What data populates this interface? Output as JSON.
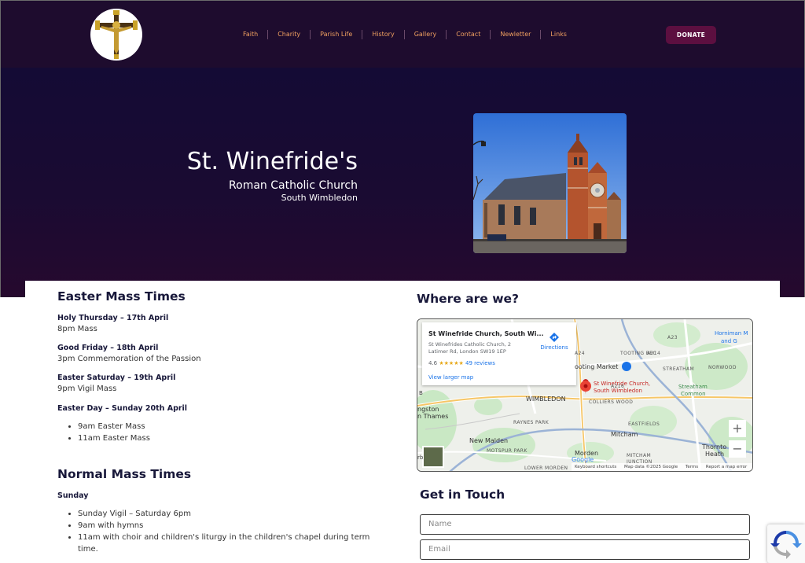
{
  "header": {
    "nav": [
      "Faith",
      "Charity",
      "Parish Life",
      "History",
      "Gallery",
      "Contact",
      "Newletter",
      "Links"
    ],
    "donate_label": "DONATE"
  },
  "hero": {
    "title": "St. Winefride's",
    "subtitle": "Roman Catholic Church",
    "location": "South Wimbledon"
  },
  "easter": {
    "heading": "Easter Mass Times",
    "holy_thursday_title": "Holy Thursday – 17th April",
    "holy_thursday_time": "8pm Mass",
    "good_friday_title": "Good Friday – 18th April",
    "good_friday_time": "3pm Commemoration of the Passion",
    "easter_saturday_title": "Easter Saturday – 19th April",
    "easter_saturday_time": "9pm Vigil Mass",
    "easter_day_title": "Easter Day – Sunday 20th April",
    "easter_day_items": [
      "9am Easter Mass",
      "11am Easter Mass"
    ]
  },
  "normal": {
    "heading": "Normal Mass Times",
    "sunday_title": "Sunday",
    "sunday_items": [
      "Sunday Vigil – Saturday 6pm",
      "9am with hymns",
      "11am with choir and children's liturgy in the children's chapel during term",
      "time."
    ]
  },
  "map": {
    "heading": "Where are we?",
    "place_name": "St Winefride Church, South Wi...",
    "address_line1": "St Winefrides Catholic Church, 2",
    "address_line2": "Latimer Rd, London SW19 1EP",
    "rating": "4.6",
    "stars": "★★★★★",
    "reviews": "49 reviews",
    "view_larger": "View larger map",
    "directions": "Directions",
    "pin_label_1": "St Winefride Church,",
    "pin_label_2": "South Wimbledon",
    "labels": {
      "tooting_market": "ooting Market",
      "tooting_bec": "TOOTING BEC",
      "streatham": "STREATHAM",
      "norwood": "NORWOOD",
      "streatham_common_1": "Streatham",
      "streatham_common_2": "Common",
      "horniman_1": "Horniman M",
      "horniman_2": "and G",
      "wimbledon": "WIMBLEDON",
      "colliers_wood": "COLLIERS WOOD",
      "kingston_1": "ngston",
      "kingston_2": "n Thames",
      "raynes_park": "RAYNES PARK",
      "eastfields": "EASTFIELDS",
      "mitcham": "Mitcham",
      "new_malden": "New Malden",
      "motspur_park": "MOTSPUR PARK",
      "morden": "Morden",
      "mitcham_junction_1": "MITCHAM",
      "mitcham_junction_2": "JUNCTION",
      "thornton_1": "Thornto",
      "thornton_2": "Heath",
      "lower_morden": "LOWER MORDEN",
      "a24": "A24",
      "a214": "A214",
      "a23": "A23",
      "a216": "A216",
      "b": "B",
      "rb": "rb"
    },
    "footer": [
      "Keyboard shortcuts",
      "Map data ©2025 Google",
      "Terms",
      "Report a map error"
    ],
    "google": "Google",
    "zoom_in": "+",
    "zoom_out": "−"
  },
  "contact": {
    "heading": "Get in Touch",
    "name_placeholder": "Name",
    "email_placeholder": "Email"
  },
  "colors": {
    "header_bg": "#1e0c2e",
    "hero_bg": "#140b35",
    "nav_text": "#f0a060",
    "donate_bg": "#5c0f40",
    "heading_text": "#18183a"
  }
}
